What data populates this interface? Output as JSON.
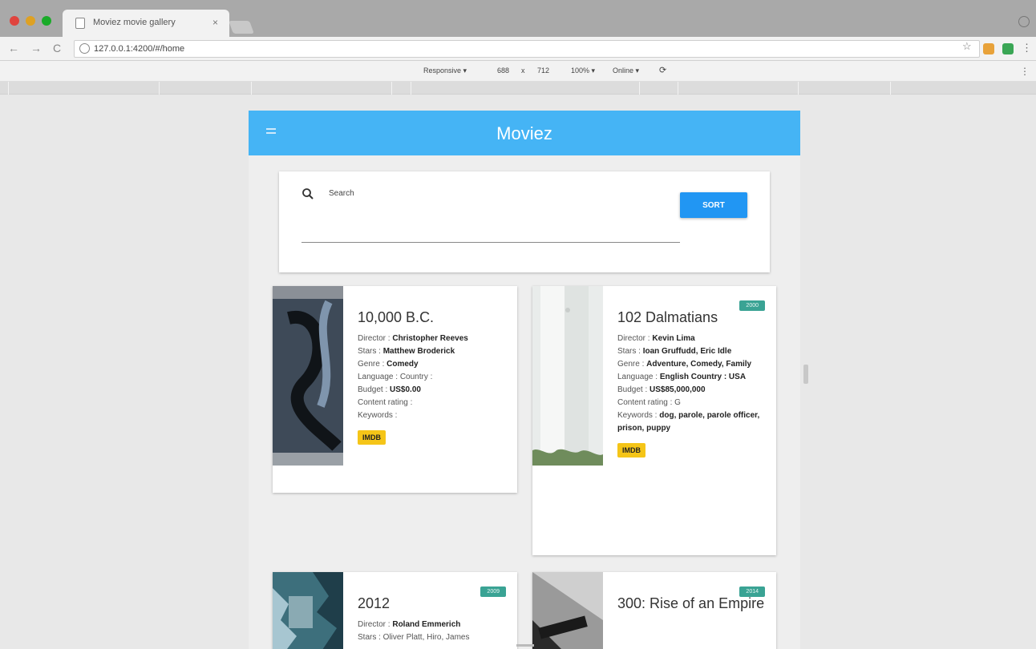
{
  "browser": {
    "tab_title": "Moviez movie gallery",
    "tab_close": "×",
    "url": "127.0.0.1:4200/#/home",
    "nav_back": "←",
    "nav_forward": "→",
    "nav_reload": "C",
    "star": "☆",
    "menu": "⋮"
  },
  "devtools": {
    "device": "Responsive ▾",
    "width": "688",
    "times": "x",
    "height": "712",
    "zoom": "100% ▾",
    "network": "Online ▾"
  },
  "app": {
    "title": "Moviez",
    "search_placeholder": "Search",
    "sort_label": "SORT"
  },
  "movies": [
    {
      "title": "10,000 B.C.",
      "director_label": "Director : ",
      "director": "Christopher Reeves",
      "stars_label": "Stars : ",
      "stars": "Matthew Broderick",
      "genre_label": "Genre : ",
      "genre": "Comedy",
      "language_label": "Language : ",
      "language": "Country :",
      "budget_label": "Budget : ",
      "budget": "US$0.00",
      "content_rating": "Content rating :",
      "keywords": "Keywords :",
      "imdb_label": "IMDB"
    },
    {
      "title": "102 Dalmatians",
      "year_badge": "2000",
      "director_label": "Director : ",
      "director": "Kevin Lima",
      "stars_label": "Stars : ",
      "stars": "Ioan Gruffudd, Eric Idle",
      "genre_label": "Genre : ",
      "genre": "Adventure, Comedy, Family",
      "language_label": "Language : ",
      "language": "English  Country : USA",
      "budget_label": "Budget : ",
      "budget": "US$85,000,000",
      "content_rating": "Content rating : G",
      "keywords_label": "Keywords : ",
      "keywords": "dog, parole, parole officer, prison, puppy",
      "imdb_label": "IMDB"
    },
    {
      "title": "2012",
      "year_badge": "2009",
      "director_label": "Director : ",
      "director": "Roland Emmerich",
      "stars_partial": "Stars : Oliver Platt, Hiro, James"
    },
    {
      "title": "300: Rise of an Empire",
      "year_badge": "2014"
    }
  ]
}
